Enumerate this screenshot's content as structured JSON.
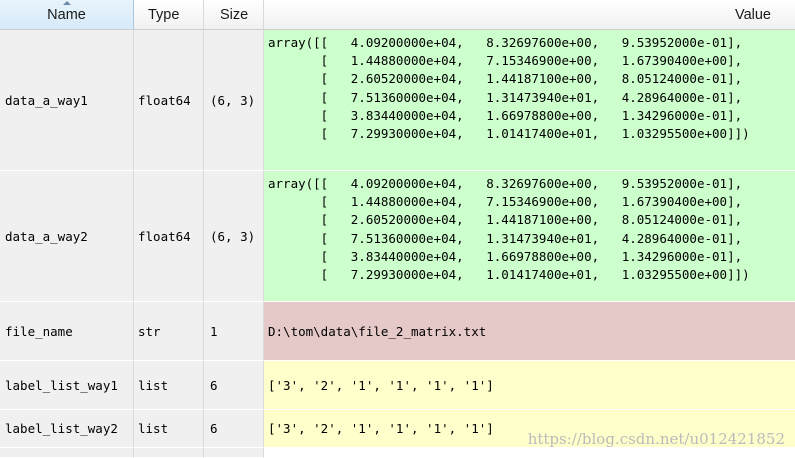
{
  "colors": {
    "array_value_bg": "#ccffcc",
    "str_value_bg": "#e5c8c8",
    "list_value_bg": "#ffffcc",
    "row_cell_bg": "#f0f0f0"
  },
  "header": {
    "name": "Name",
    "type": "Type",
    "size": "Size",
    "value": "Value",
    "sort_icon": "sort-ascending-icon"
  },
  "rows": [
    {
      "name": "data_a_way1",
      "type": "float64",
      "size": "(6, 3)",
      "value": "array([[   4.09200000e+04,   8.32697600e+00,   9.53952000e-01],\n       [   1.44880000e+04,   7.15346900e+00,   1.67390400e+00],\n       [   2.60520000e+04,   1.44187100e+00,   8.05124000e-01],\n       [   7.51360000e+04,   1.31473940e+01,   4.28964000e-01],\n       [   3.83440000e+04,   1.66978800e+00,   1.34296000e-01],\n       [   7.29930000e+04,   1.01417400e+01,   1.03295500e+00]])"
    },
    {
      "name": "data_a_way2",
      "type": "float64",
      "size": "(6, 3)",
      "value": "array([[   4.09200000e+04,   8.32697600e+00,   9.53952000e-01],\n       [   1.44880000e+04,   7.15346900e+00,   1.67390400e+00],\n       [   2.60520000e+04,   1.44187100e+00,   8.05124000e-01],\n       [   7.51360000e+04,   1.31473940e+01,   4.28964000e-01],\n       [   3.83440000e+04,   1.66978800e+00,   1.34296000e-01],\n       [   7.29930000e+04,   1.01417400e+01,   1.03295500e+00]])"
    },
    {
      "name": "file_name",
      "type": "str",
      "size": "1",
      "value": "D:\\tom\\data\\file_2_matrix.txt"
    },
    {
      "name": "label_list_way1",
      "type": "list",
      "size": "6",
      "value": "['3', '2', '1', '1', '1', '1']"
    },
    {
      "name": "label_list_way2",
      "type": "list",
      "size": "6",
      "value": "['3', '2', '1', '1', '1', '1']"
    }
  ],
  "watermark": "https://blog.csdn.net/u012421852"
}
